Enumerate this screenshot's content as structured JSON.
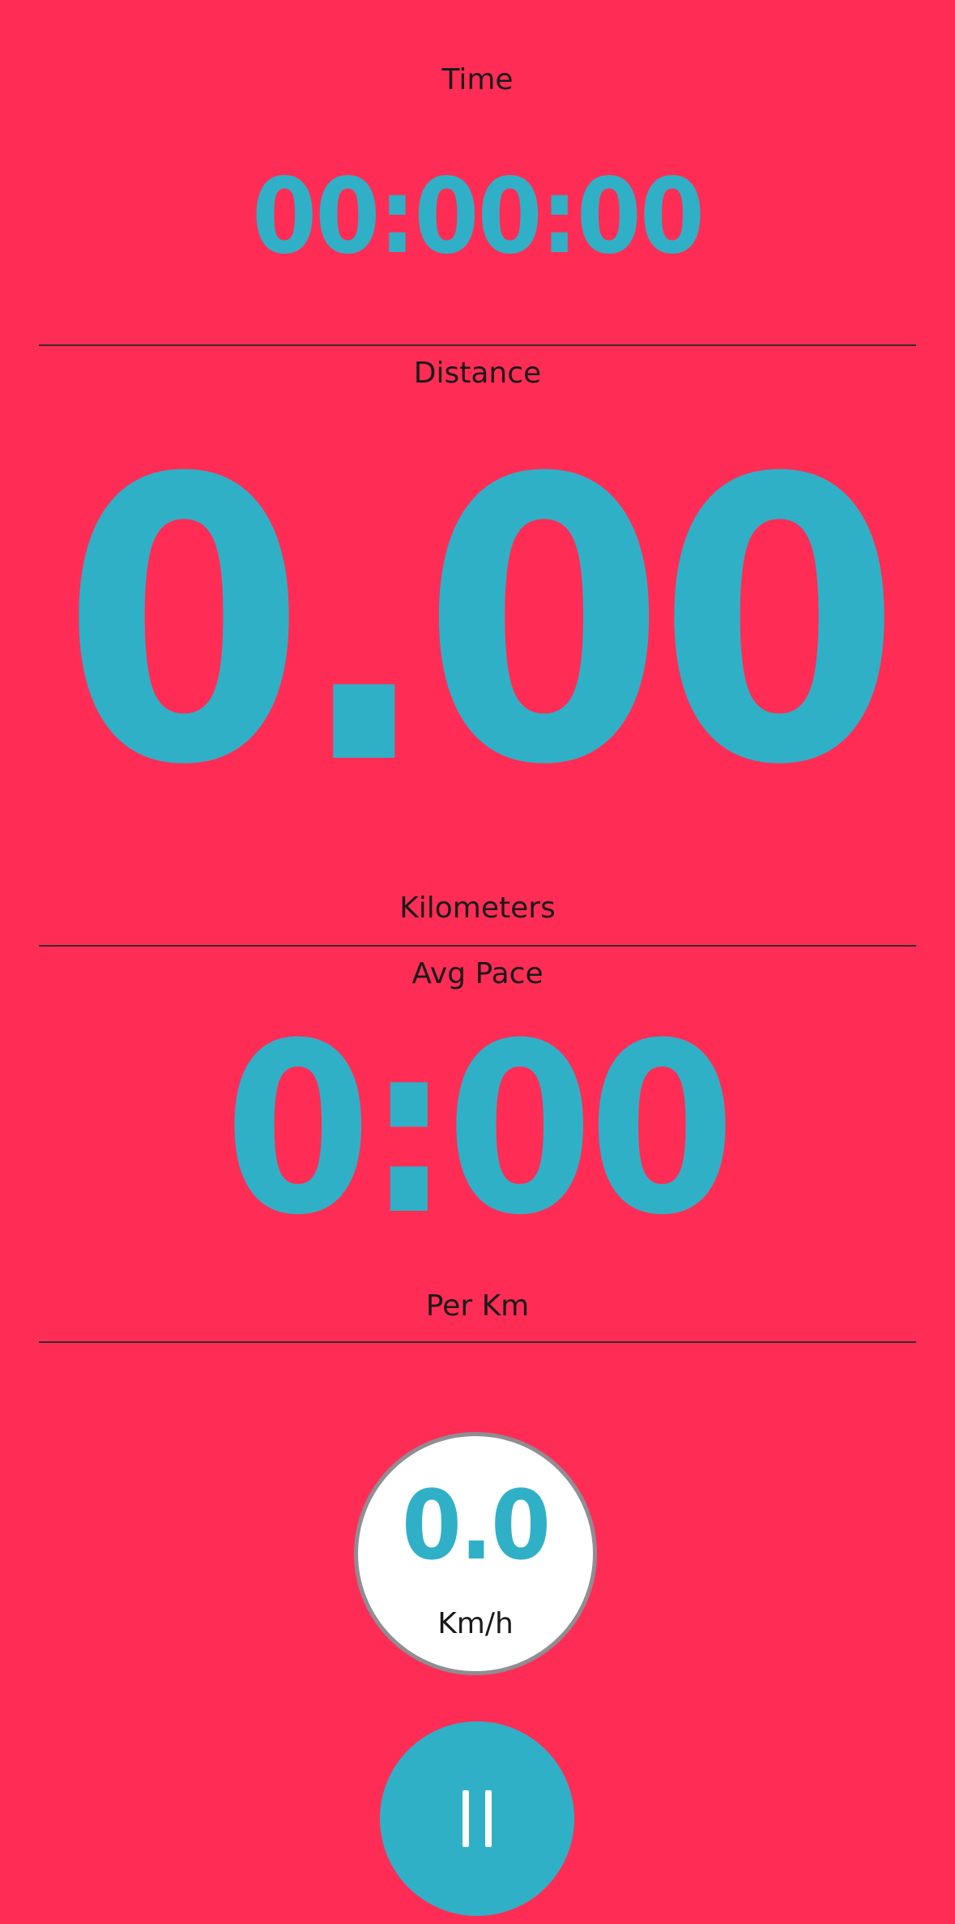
{
  "time": {
    "label": "Time",
    "value": "00:00:00"
  },
  "distance": {
    "label": "Distance",
    "value": "0.00",
    "unit": "Kilometers"
  },
  "pace": {
    "label": "Avg Pace",
    "value": "0:00",
    "unit": "Per Km"
  },
  "speed": {
    "value": "0.0",
    "unit": "Km/h"
  },
  "controls": {
    "pause_icon": "pause-icon"
  },
  "colors": {
    "background": "#ff2d55",
    "accent": "#30b0c7",
    "circle_fill": "#ffffff",
    "circle_border": "#8e8e93"
  }
}
